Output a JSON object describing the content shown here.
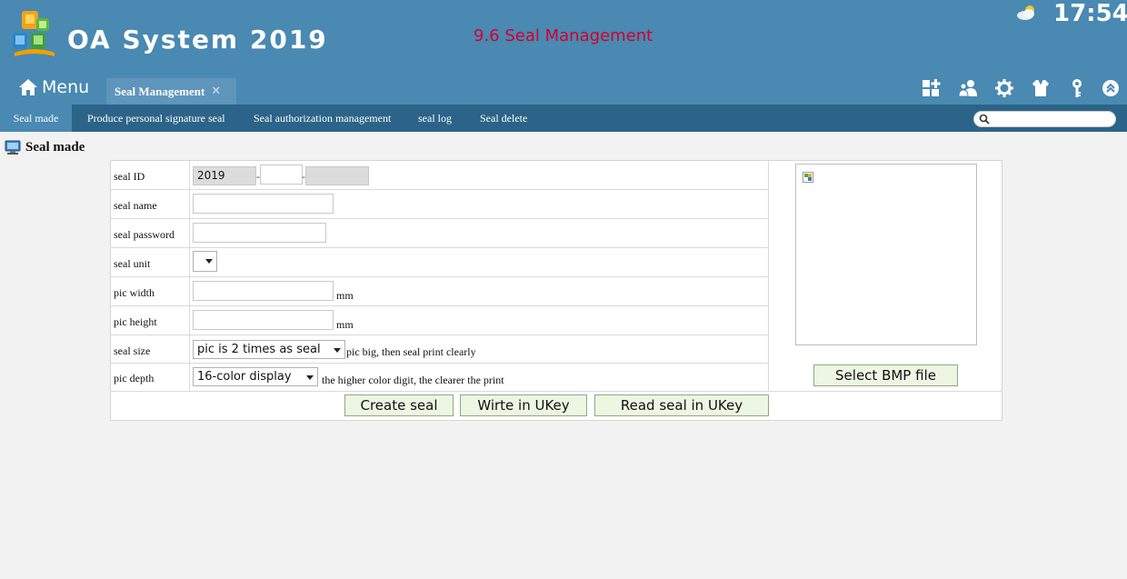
{
  "header": {
    "app_title": "OA System 2019",
    "doc_title": "9.6 Seal Management",
    "clock": "17:54",
    "weather_icon": "partly-cloudy-icon",
    "menu_label": "Menu",
    "active_tab": "Seal Management",
    "toolbar_icons": [
      "add-module-icon",
      "users-icon",
      "gear-icon",
      "shirt-icon",
      "key-icon",
      "collapse-up-icon"
    ]
  },
  "subnav": {
    "items": [
      "Seal made",
      "Produce personal signature seal",
      "Seal authorization management",
      "seal log",
      "Seal delete"
    ],
    "active_index": 0,
    "search_placeholder": ""
  },
  "page": {
    "title": "Seal made"
  },
  "form": {
    "seal_id": {
      "label": "seal ID",
      "part1": "2019",
      "part2": "",
      "part3": ""
    },
    "seal_name": {
      "label": "seal name",
      "value": ""
    },
    "seal_password": {
      "label": "seal password",
      "value": ""
    },
    "seal_unit": {
      "label": "seal unit",
      "value": ""
    },
    "pic_width": {
      "label": "pic width",
      "value": "",
      "unit": "mm"
    },
    "pic_height": {
      "label": "pic height",
      "value": "",
      "unit": "mm"
    },
    "seal_size": {
      "label": "seal size",
      "value": "pic is 2 times as seal",
      "hint": "pic big, then seal print clearly"
    },
    "pic_depth": {
      "label": "pic depth",
      "value": "16-color display",
      "hint": "the higher color digit, the clearer the print"
    },
    "select_bmp_label": "Select BMP file"
  },
  "actions": {
    "create_seal": "Create seal",
    "write_ukey": "Wirte in UKey",
    "read_ukey": "Read seal in UKey"
  },
  "colors": {
    "header_bg": "#4989b2",
    "subnav_bg": "#2b6488",
    "doc_title": "#d3002e",
    "button_bg": "#edf5e3"
  }
}
